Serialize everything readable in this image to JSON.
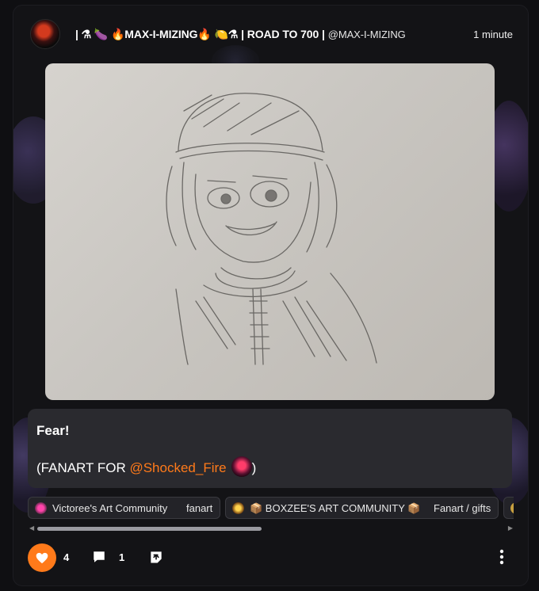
{
  "post": {
    "author_display": "| ⚗ 🍆 🔥MAX-I-MIZING🔥 🍋⚗ | ROAD TO 700 |",
    "author_handle": "@MAX-I-MIZING",
    "time": "1 minute",
    "caption_title": "Fear!",
    "caption_prefix": "(FANART FOR ",
    "caption_mention": "@Shocked_Fire",
    "caption_suffix": ")"
  },
  "tags": [
    {
      "name": "Victoree's Art Community",
      "sub": "fanart"
    },
    {
      "name": "📦 BOXZEE'S ART COMMUNITY 📦",
      "sub": "Fanart / gifts"
    }
  ],
  "actions": {
    "like_count": "4",
    "comment_count": "1"
  },
  "colors": {
    "accent": "#ff7a1a",
    "card_bg": "#131316",
    "caption_bg": "#2a2a2f"
  },
  "icons": {
    "like": "heart-icon",
    "comment": "comment-icon",
    "share": "share-icon",
    "more": "more-vertical-icon"
  }
}
